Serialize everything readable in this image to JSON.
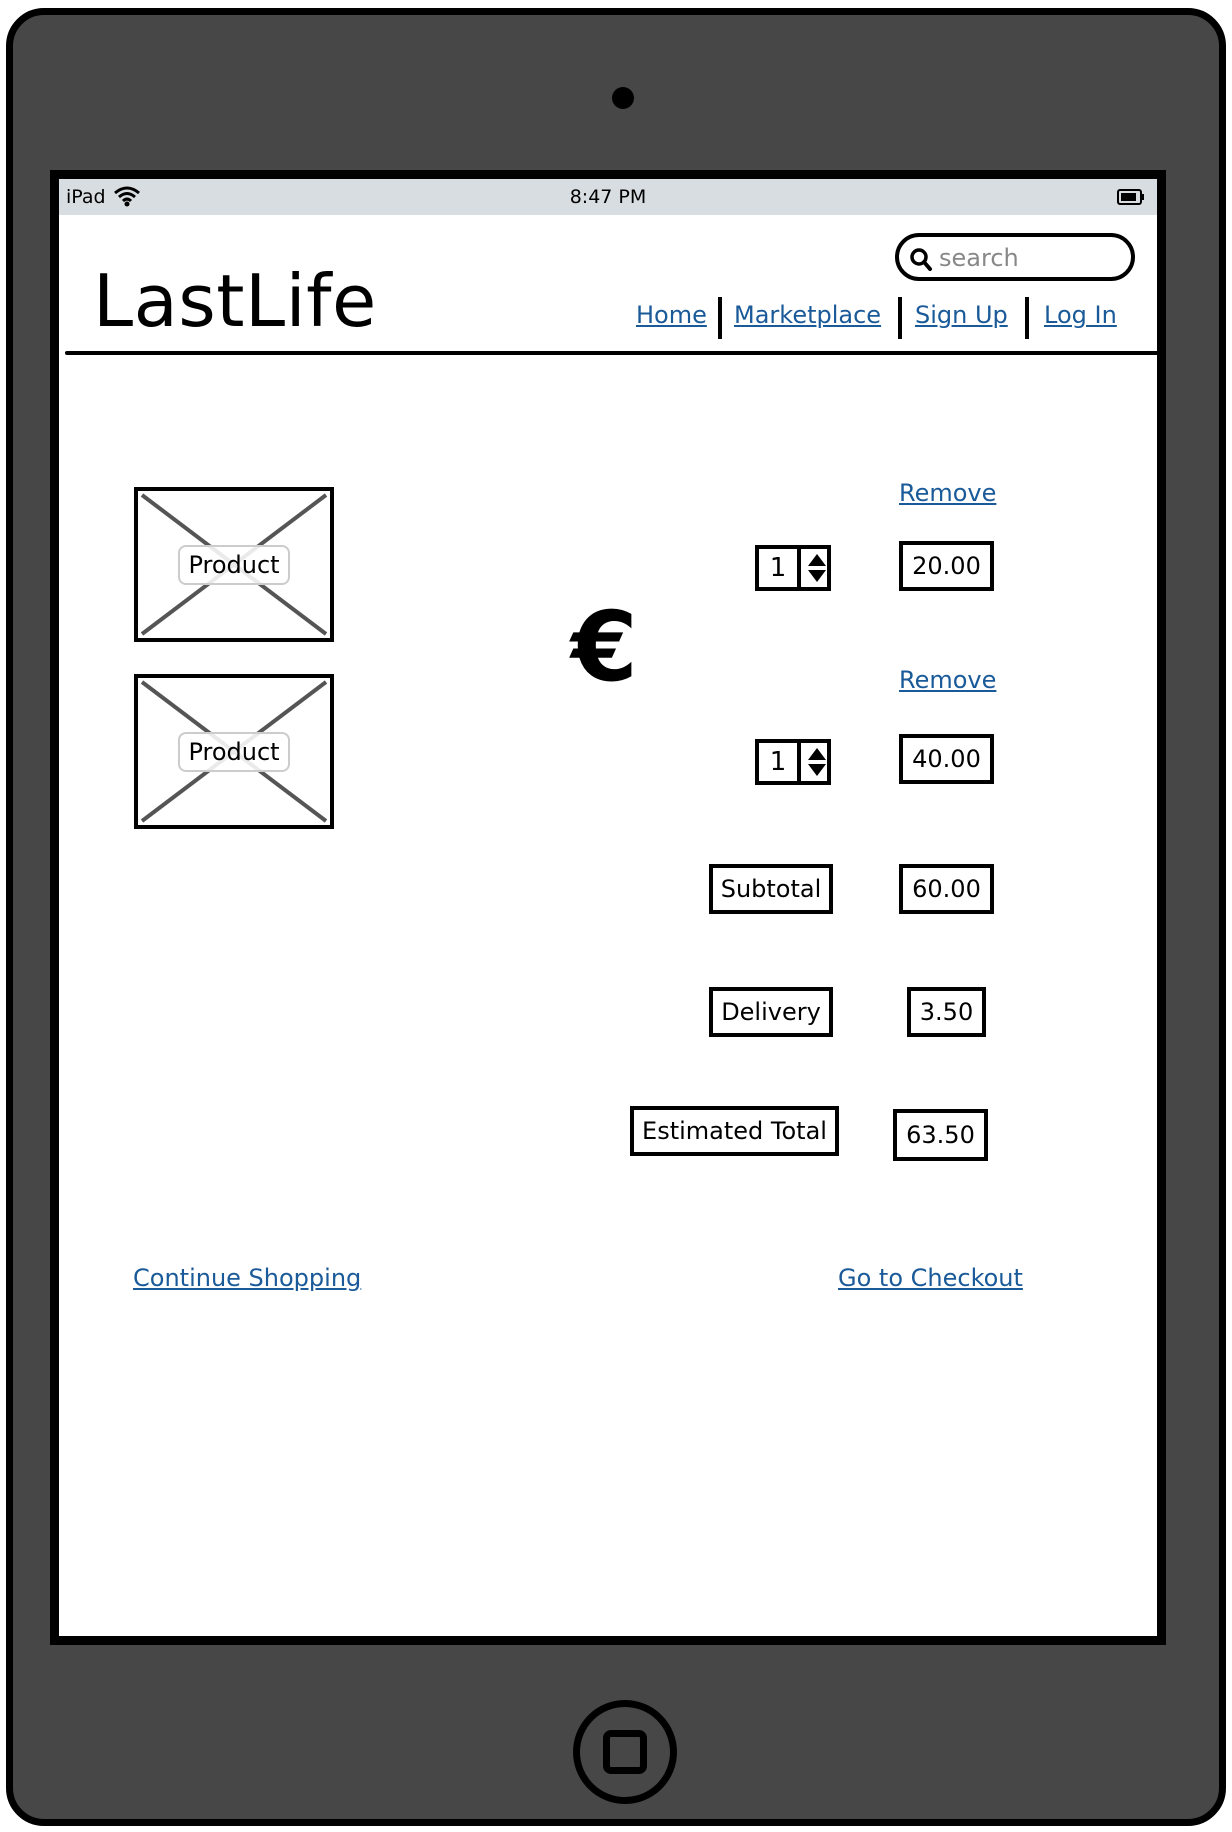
{
  "status_bar": {
    "device": "iPad",
    "time": "8:47 PM"
  },
  "header": {
    "logo": "LastLife",
    "search_placeholder": "search",
    "nav": [
      "Home",
      "Marketplace",
      "Sign Up",
      "Log In"
    ]
  },
  "cart": {
    "currency_symbol": "€",
    "items": [
      {
        "image_label": "Product",
        "remove_label": "Remove",
        "quantity": "1",
        "price": "20.00"
      },
      {
        "image_label": "Product",
        "remove_label": "Remove",
        "quantity": "1",
        "price": "40.00"
      }
    ],
    "summary": {
      "subtotal_label": "Subtotal",
      "subtotal_value": "60.00",
      "delivery_label": "Delivery",
      "delivery_value": "3.50",
      "total_label": "Estimated Total",
      "total_value": "63.50"
    }
  },
  "footer_links": {
    "continue": "Continue Shopping",
    "checkout": "Go to Checkout"
  },
  "colors": {
    "link": "#1a5a99",
    "device_body": "#474747",
    "status_bar": "#d8dde1"
  }
}
